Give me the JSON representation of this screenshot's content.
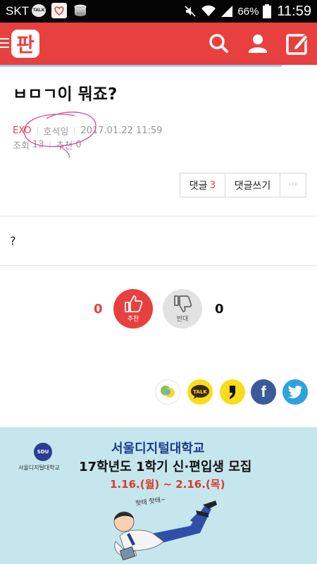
{
  "status_bar": {
    "carrier": "SKT",
    "talk_icon_text": "TALK",
    "battery_percent": "66%",
    "time": "11:59"
  },
  "header": {
    "logo_text": "판",
    "icons": [
      "menu-icon",
      "search-icon",
      "user-icon",
      "edit-icon"
    ],
    "brand_color": "#e8403f"
  },
  "post": {
    "title": "ㅂㅁㄱ이 뭐죠?",
    "category": "EXO",
    "author": "호석잉",
    "date": "2017.01.22 11:59",
    "views_label": "조회",
    "views": "13",
    "recommend_label": "추천",
    "recommend_count": "0",
    "content": "?"
  },
  "actions": {
    "comments_label": "댓글",
    "comments_count": "3",
    "write_comment_label": "댓글쓰기",
    "more_label": "···"
  },
  "votes": {
    "up_count": "0",
    "up_label": "추천",
    "down_count": "0",
    "down_label": "반대"
  },
  "share": {
    "icons": [
      "kakaostory-icon",
      "kakaotalk-icon",
      "quote-icon",
      "facebook-icon",
      "twitter-icon"
    ],
    "talk_text": "TALK",
    "facebook_text": "f"
  },
  "ad": {
    "logo_text": "SDU",
    "logo_caption": "서울디지털대학교",
    "line1": "서울디지털대학교",
    "line2": "17학년도 1학기 신·편입생 모집",
    "line3": "1.16.(월) ~ 2.16.(목)",
    "handwriting": "핫태 핫태~"
  }
}
